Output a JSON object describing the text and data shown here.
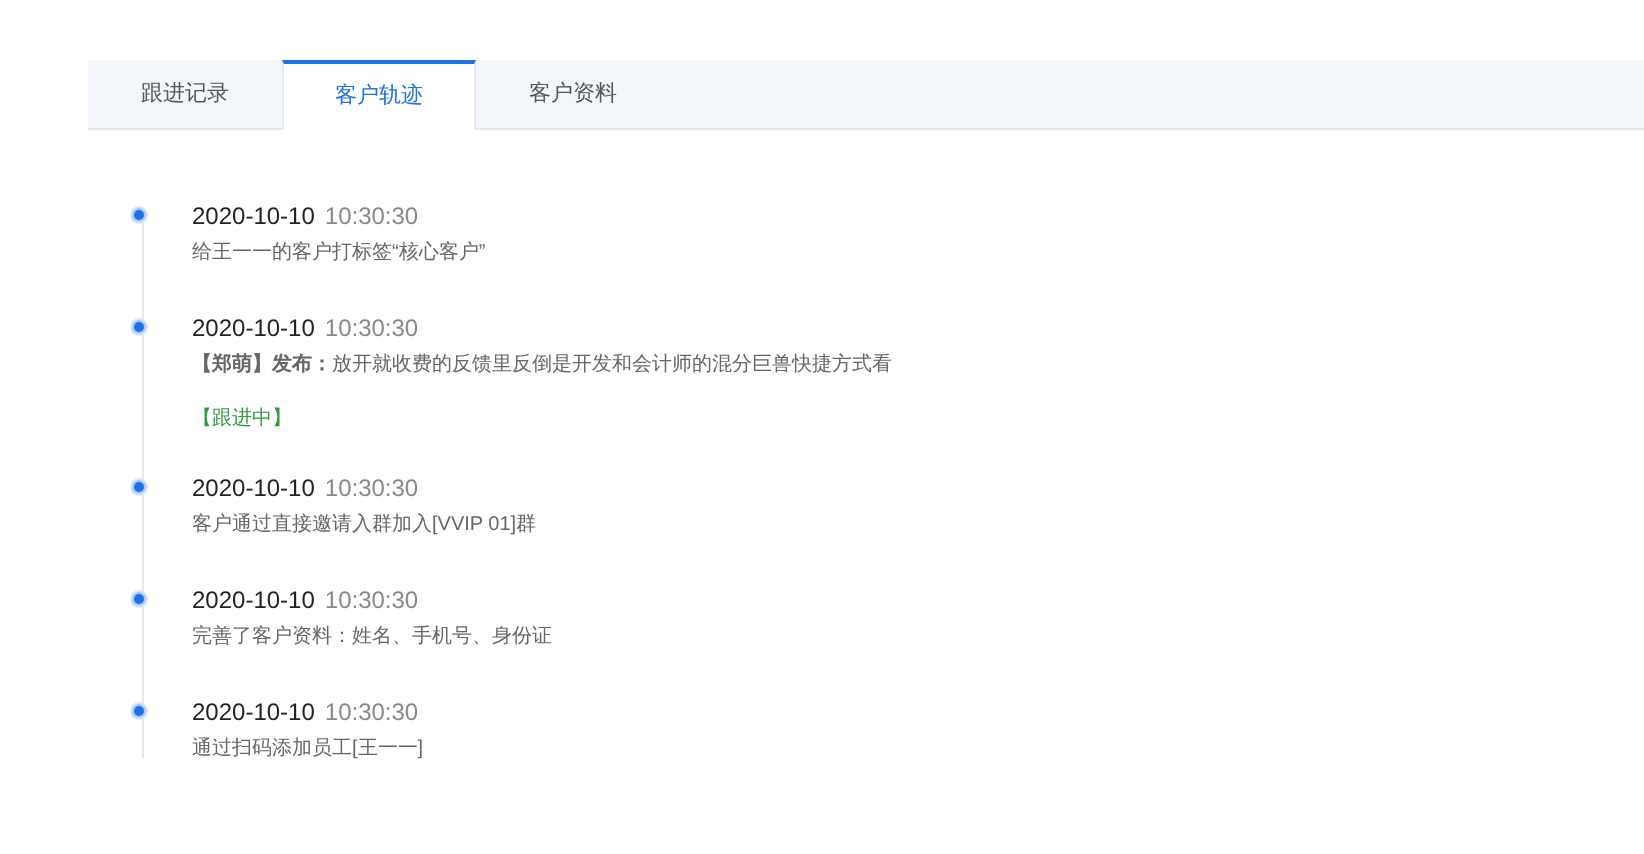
{
  "tabs": [
    {
      "label": "跟进记录",
      "selected": false
    },
    {
      "label": "客户轨迹",
      "selected": true
    },
    {
      "label": "客户资料",
      "selected": false
    }
  ],
  "timeline": [
    {
      "date": "2020-10-10",
      "time": "10:30:30",
      "text": "给王一一的客户打标签“核心客户”"
    },
    {
      "date": "2020-10-10",
      "time": "10:30:30",
      "text": "**【郑萌】发布：**放开就收费的反馈里反倒是开发和会计师的混分巨兽快捷方式看",
      "tag": "【跟进中】"
    },
    {
      "date": "2020-10-10",
      "time": "10:30:30",
      "text": "客户通过直接邀请入群加入[VVIP 01]群"
    },
    {
      "date": "2020-10-10",
      "time": "10:30:30",
      "text": "完善了客户资料：姓名、手机号、身份证"
    },
    {
      "date": "2020-10-10",
      "time": "10:30:30",
      "text": "通过扫码添加员工[王一一]"
    }
  ]
}
